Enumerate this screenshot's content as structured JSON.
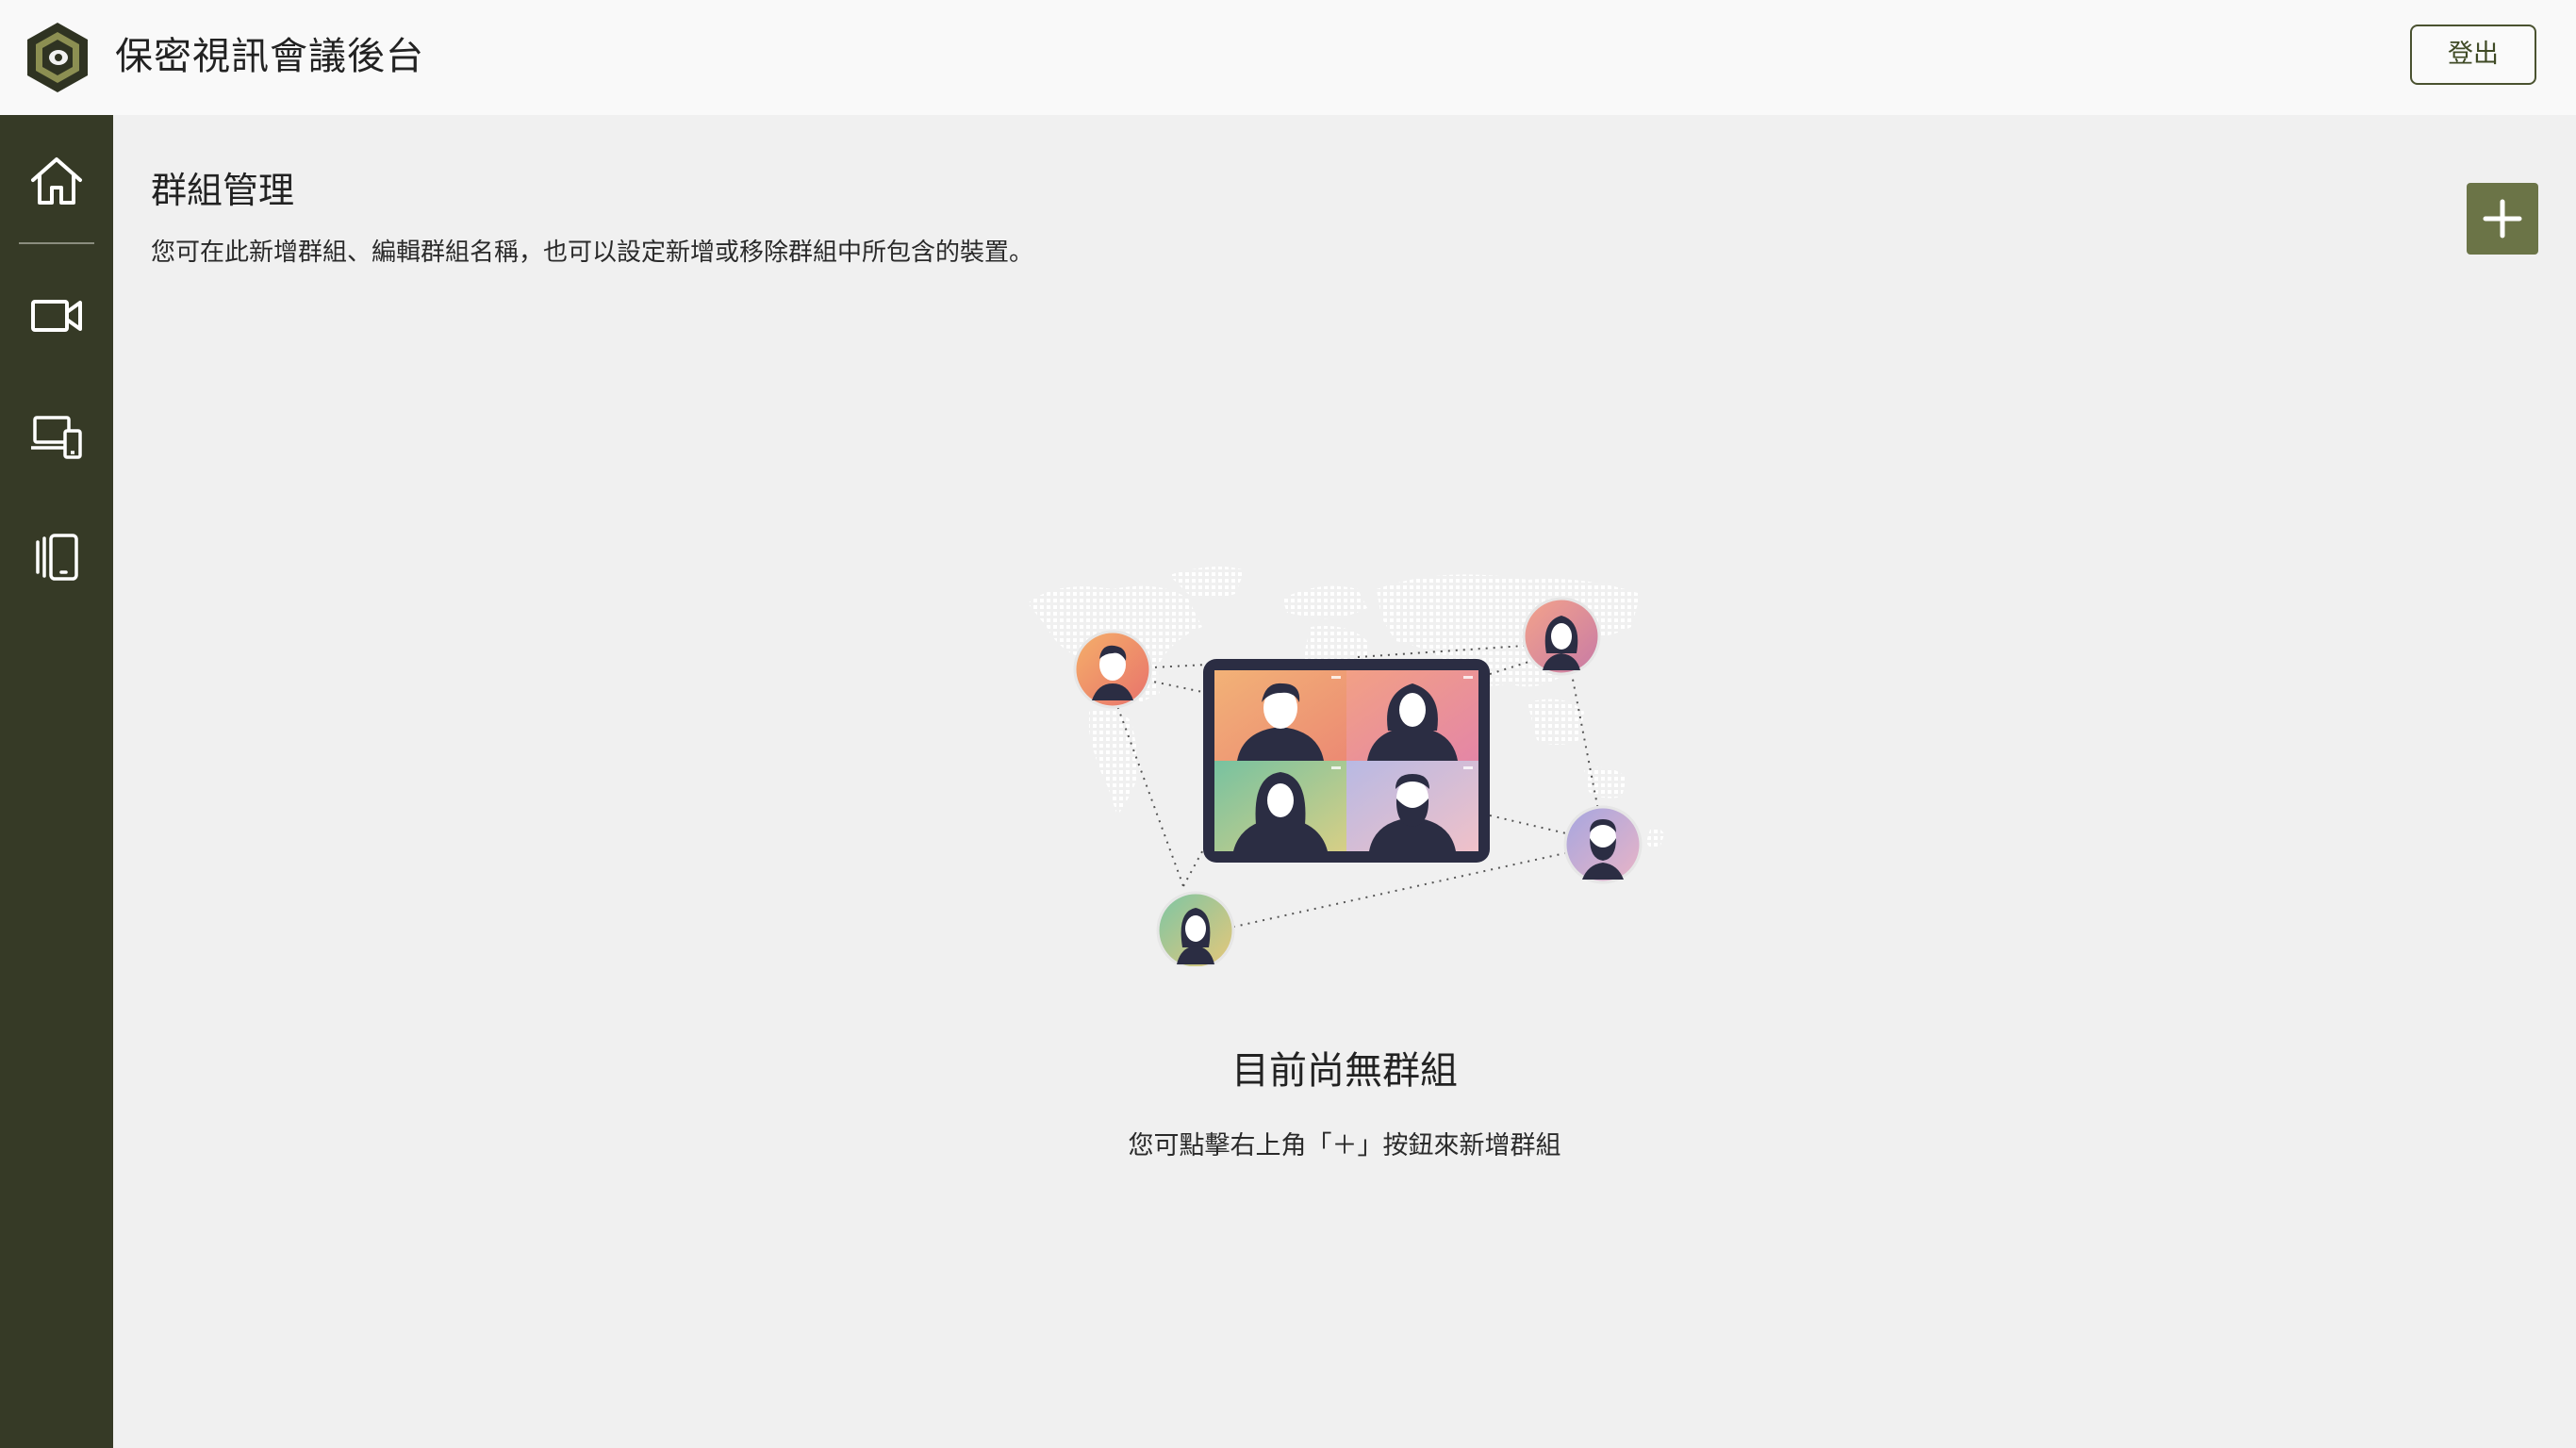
{
  "header": {
    "title": "保密視訊會議後台",
    "logout_label": "登出"
  },
  "sidebar": {
    "items": [
      {
        "icon": "home-icon"
      },
      {
        "icon": "video-camera-icon"
      },
      {
        "icon": "devices-icon"
      },
      {
        "icon": "tablet-group-icon"
      }
    ]
  },
  "main": {
    "title": "群組管理",
    "description": "您可在此新增群組、編輯群組名稱，也可以設定新增或移除群組中所包含的裝置。",
    "add_button_icon": "plus-icon",
    "empty_state": {
      "title": "目前尚無群組",
      "hint": "您可點擊右上角「＋」按鈕來新增群組"
    }
  },
  "colors": {
    "sidebar_bg": "#363a26",
    "accent": "#6b7447",
    "page_bg": "#f0f0f0",
    "topbar_bg": "#f9f9f9"
  }
}
